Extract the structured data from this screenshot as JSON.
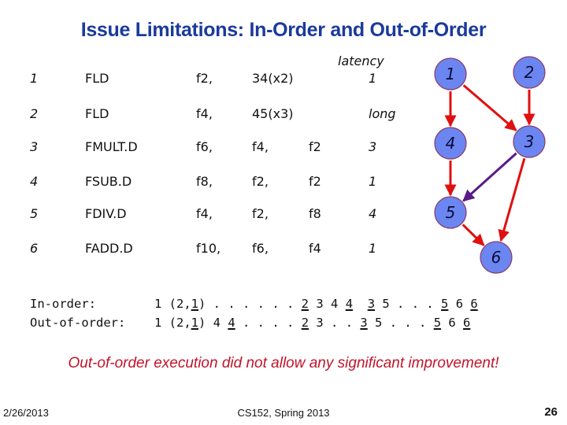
{
  "slide": {
    "title": "Issue Limitations: In-Order and Out-of-Order",
    "latency_header": "latency",
    "instructions": [
      {
        "num": "1",
        "op": "FLD",
        "dst": "f2,",
        "src1": "34(x2)",
        "src2": "",
        "latency": "1"
      },
      {
        "num": "2",
        "op": "FLD",
        "dst": "f4,",
        "src1": "45(x3)",
        "src2": "",
        "latency": "long"
      },
      {
        "num": "3",
        "op": "FMULT.D",
        "dst": "f6,",
        "src1": "f4,",
        "src2": "f2",
        "latency": "3"
      },
      {
        "num": "4",
        "op": "FSUB.D",
        "dst": "f8,",
        "src1": "f2,",
        "src2": "f2",
        "latency": "1"
      },
      {
        "num": "5",
        "op": "FDIV.D",
        "dst": "f4,",
        "src1": "f2,",
        "src2": "f8",
        "latency": "4"
      },
      {
        "num": "6",
        "op": "FADD.D",
        "dst": "f10,",
        "src1": "f6,",
        "src2": "f4",
        "latency": "1"
      }
    ],
    "schedules": {
      "in_order_label": "In-order:",
      "out_of_order_label": "Out-of-order:",
      "in_order_tokens": [
        {
          "t": "1 (2,",
          "u": false
        },
        {
          "t": "1",
          "u": true
        },
        {
          "t": ") . . . . . . ",
          "u": false
        },
        {
          "t": "2",
          "u": true
        },
        {
          "t": " 3 4 ",
          "u": false
        },
        {
          "t": "4",
          "u": true
        },
        {
          "t": "  ",
          "u": false
        },
        {
          "t": "3",
          "u": true
        },
        {
          "t": " 5 . . . ",
          "u": false
        },
        {
          "t": "5",
          "u": true
        },
        {
          "t": " 6 ",
          "u": false
        },
        {
          "t": "6",
          "u": true
        }
      ],
      "out_of_order_tokens": [
        {
          "t": "1 (2,",
          "u": false
        },
        {
          "t": "1",
          "u": true
        },
        {
          "t": ") 4 ",
          "u": false
        },
        {
          "t": "4",
          "u": true
        },
        {
          "t": " . . . . ",
          "u": false
        },
        {
          "t": "2",
          "u": true
        },
        {
          "t": " 3 . . ",
          "u": false
        },
        {
          "t": "3",
          "u": true
        },
        {
          "t": " 5 . . . ",
          "u": false
        },
        {
          "t": "5",
          "u": true
        },
        {
          "t": " 6 ",
          "u": false
        },
        {
          "t": "6",
          "u": true
        }
      ]
    },
    "conclusion": "Out-of-order execution did not allow any significant improvement!",
    "footer": {
      "date": "2/26/2013",
      "course": "CS152, Spring 2013",
      "page": "26"
    },
    "graph": {
      "node_fill": "#6b86f0",
      "node_stroke": "#8a3a6a",
      "edge_color": "#e01010",
      "highlight_edge_color": "#5a1a8a",
      "nodes": [
        "1",
        "2",
        "3",
        "4",
        "5",
        "6"
      ],
      "edges": [
        {
          "from": "1",
          "to": "4",
          "highlight": false
        },
        {
          "from": "1",
          "to": "3",
          "highlight": false
        },
        {
          "from": "2",
          "to": "3",
          "highlight": false
        },
        {
          "from": "4",
          "to": "5",
          "highlight": false
        },
        {
          "from": "3",
          "to": "5",
          "highlight": true
        },
        {
          "from": "3",
          "to": "6",
          "highlight": false
        },
        {
          "from": "5",
          "to": "6",
          "highlight": false
        }
      ]
    }
  }
}
